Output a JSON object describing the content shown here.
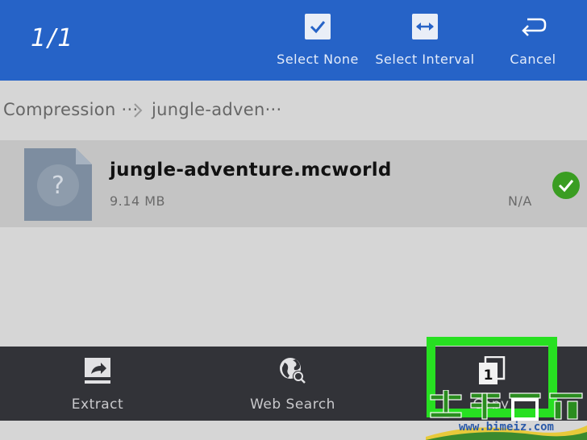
{
  "topbar": {
    "selection_count": "1/1",
    "actions": [
      {
        "label": "Select None",
        "icon": "checkbox-icon"
      },
      {
        "label": "Select Interval",
        "icon": "double-arrow-icon"
      },
      {
        "label": "Cancel",
        "icon": "return-arrow-icon"
      }
    ]
  },
  "breadcrumb": {
    "items": [
      "Compression ···",
      "jungle-adven···"
    ]
  },
  "file": {
    "name": "jungle-adventure.mcworld",
    "size": "9.14 MB",
    "date": "N/A",
    "selected": true,
    "icon": "unknown-file-icon"
  },
  "bottombar": {
    "buttons": [
      {
        "label": "Extract",
        "icon": "extract-icon"
      },
      {
        "label": "Web Search",
        "icon": "globe-search-icon"
      },
      {
        "label": "Copy",
        "icon": "copy-icon",
        "badge": "1",
        "highlighted": true
      }
    ]
  },
  "watermark": {
    "text": "www.bimeiz.com"
  },
  "colors": {
    "topbar": "#2663c7",
    "bottombar": "#323338",
    "highlight": "#27e021",
    "check": "#3a9d22"
  }
}
